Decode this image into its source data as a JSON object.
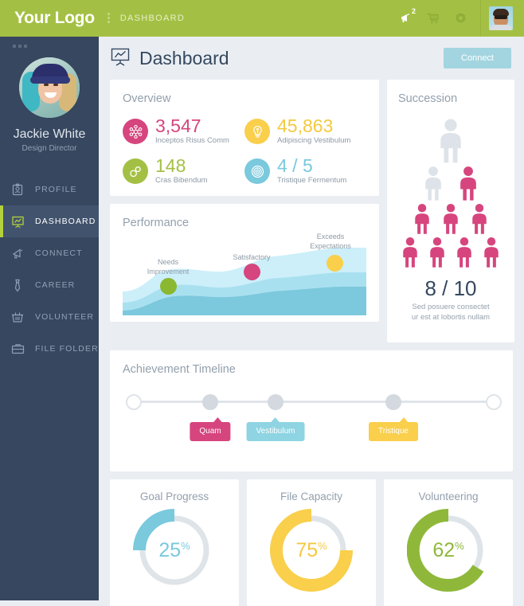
{
  "topbar": {
    "logo": "Your Logo",
    "breadcrumb": "DASHBOARD",
    "icons": [
      {
        "name": "megaphone-icon",
        "badge": "2"
      },
      {
        "name": "cart-icon",
        "badge": ""
      },
      {
        "name": "gear-icon",
        "badge": ""
      }
    ],
    "avatar_name": "user-avatar",
    "bg": "#a4c044"
  },
  "sidebar": {
    "user_name": "Jackie White",
    "user_role": "Design Director",
    "items": [
      {
        "label": "PROFILE",
        "icon": "id-card-icon",
        "active": false
      },
      {
        "label": "DASHBOARD",
        "icon": "presentation-chart-icon",
        "active": true
      },
      {
        "label": "CONNECT",
        "icon": "megaphone-icon",
        "active": false
      },
      {
        "label": "CAREER",
        "icon": "tie-icon",
        "active": false
      },
      {
        "label": "VOLUNTEER",
        "icon": "basket-icon",
        "active": false
      },
      {
        "label": "FILE FOLDER",
        "icon": "briefcase-icon",
        "active": false
      }
    ],
    "bg": "#36475f",
    "active_bg": "#42536d",
    "active_accent": "#b3d13f"
  },
  "page": {
    "title": "Dashboard",
    "title_icon": "presentation-chart-icon",
    "connect_label": "Connect",
    "connect_color": "#a3d5e0"
  },
  "overview": {
    "title": "Overview",
    "stats": [
      {
        "value": "3,547",
        "label": "Inceptos Risus Comm",
        "color": "#d6457e",
        "icon": "molecule-icon"
      },
      {
        "value": "45,863",
        "label": "Adipiscing Vestibulum",
        "color": "#f9cf4b",
        "icon": "lightbulb-icon"
      },
      {
        "value": "148",
        "label": "Cras Bibendum",
        "color": "#a4c044",
        "icon": "rings-icon"
      },
      {
        "value": "4 / 5",
        "label": "Tristique Fermentum",
        "color": "#7ac9dd",
        "icon": "target-icon"
      }
    ]
  },
  "performance": {
    "title": "Performance",
    "markers": [
      {
        "label": "Needs\nImprovement",
        "label_line1": "Needs",
        "label_line2": "Improvement",
        "color": "#8bb831",
        "x": 58,
        "y": 72
      },
      {
        "label": "Satisfactory",
        "label_line1": "Satisfactory",
        "label_line2": "",
        "color": "#d6457e",
        "x": 176,
        "y": 44
      },
      {
        "label": "Exceeds\nExpectations",
        "label_line1": "Exceeds",
        "label_line2": "Expectations",
        "color": "#f9cf4b",
        "x": 268,
        "y": 25
      }
    ],
    "band_colors": [
      "#cceffa",
      "#a9e0f0",
      "#7cc8dd"
    ]
  },
  "succession": {
    "title": "Succession",
    "score": "8 / 10",
    "caption_line1": "Sed posuere consectet",
    "caption_line2": "ur est at lobortis nullam",
    "filled_color": "#d6457e",
    "empty_color": "#dde3e8",
    "rows": [
      {
        "size": "lg",
        "people": [
          "empty"
        ]
      },
      {
        "size": "md",
        "people": [
          "empty",
          "filled"
        ]
      },
      {
        "size": "sm",
        "people": [
          "filled",
          "filled",
          "filled"
        ]
      },
      {
        "size": "sm",
        "people": [
          "filled",
          "filled",
          "filled",
          "filled"
        ]
      }
    ]
  },
  "timeline": {
    "title": "Achievement Timeline",
    "nodes": [
      {
        "type": "hollow",
        "x": 14
      },
      {
        "type": "filled",
        "x": 110
      },
      {
        "type": "filled",
        "x": 192
      },
      {
        "type": "filled",
        "x": 340
      },
      {
        "type": "hollow",
        "x": 466
      }
    ],
    "tips": [
      {
        "label": "Quam",
        "color": "#d6457e",
        "x": 110
      },
      {
        "label": "Vestibulum",
        "color": "#8ed4e2",
        "x": 192
      },
      {
        "label": "Tristique",
        "color": "#f9cf4b",
        "x": 340
      }
    ]
  },
  "chart_data": [
    {
      "type": "area",
      "title": "Performance",
      "series": [
        {
          "name": "band-1",
          "color": "#cceffa",
          "values": [
            18,
            20,
            34,
            40,
            42,
            44,
            52,
            60,
            64,
            66
          ]
        },
        {
          "name": "band-2",
          "color": "#a9e0f0",
          "values": [
            10,
            12,
            20,
            26,
            28,
            30,
            36,
            42,
            44,
            46
          ]
        },
        {
          "name": "band-3",
          "color": "#7cc8dd",
          "values": [
            4,
            5,
            12,
            18,
            20,
            22,
            26,
            30,
            32,
            33
          ]
        }
      ],
      "annotations": [
        "Needs Improvement",
        "Satisfactory",
        "Exceeds Expectations"
      ],
      "xlabel": "",
      "ylabel": "",
      "grid": false,
      "legend": "none"
    },
    {
      "type": "pie",
      "title": "Goal Progress",
      "categories": [
        "complete",
        "remaining"
      ],
      "values": [
        25,
        75
      ],
      "value_label": "25",
      "unit": "%",
      "color": "#7ac9dd",
      "track_color": "#dfe4e9"
    },
    {
      "type": "pie",
      "title": "File Capacity",
      "categories": [
        "complete",
        "remaining"
      ],
      "values": [
        75,
        25
      ],
      "value_label": "75",
      "unit": "%",
      "color": "#f9cf4b",
      "track_color": "#dfe4e9"
    },
    {
      "type": "pie",
      "title": "Volunteering",
      "categories": [
        "complete",
        "remaining"
      ],
      "values": [
        62,
        38
      ],
      "value_label": "62",
      "unit": "%",
      "color": "#8fb83a",
      "track_color": "#dfe4e9"
    }
  ]
}
